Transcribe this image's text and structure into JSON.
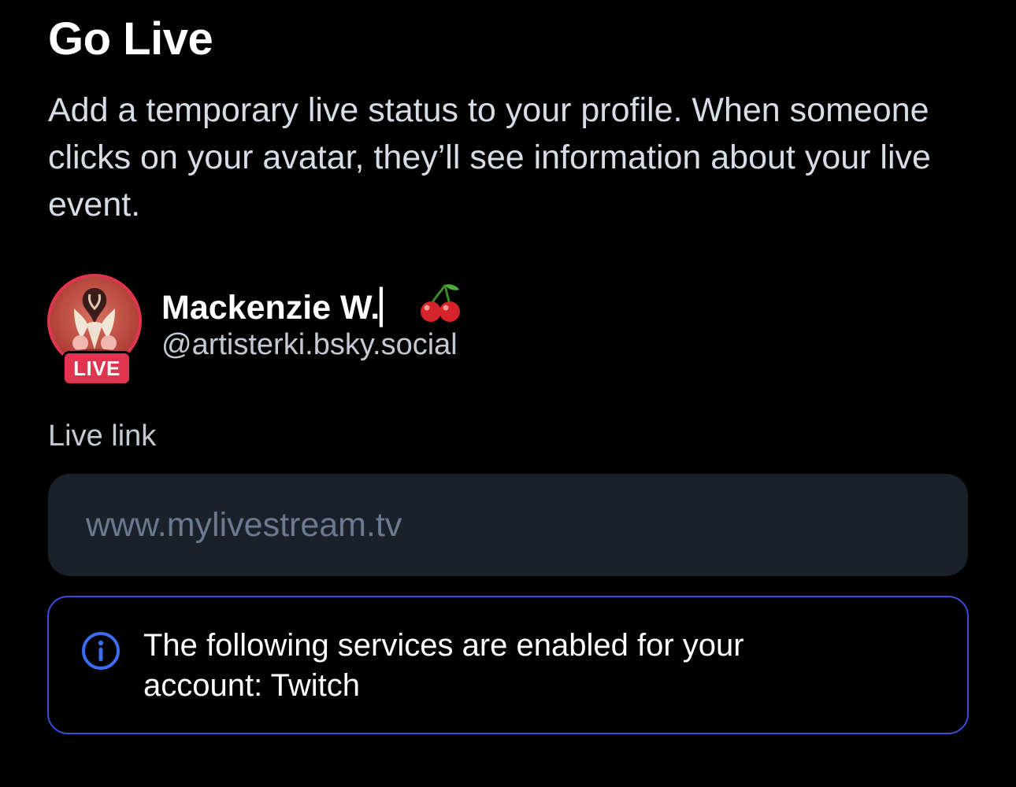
{
  "page": {
    "title": "Go Live",
    "description": "Add a temporary live status to your profile. When someone clicks on your avatar, they’ll see information about your live event."
  },
  "profile": {
    "display_name": "Mackenzie W.▏",
    "display_name_emoji": "🍒",
    "handle": "@artisterki.bsky.social",
    "live_badge": "LIVE",
    "avatar_icon": "avatar-illustration"
  },
  "live_link": {
    "label": "Live link",
    "value": "",
    "placeholder": "www.mylivestream.tv"
  },
  "notice": {
    "icon": "info-icon",
    "text": "The following services are enabled for your account: Twitch"
  },
  "colors": {
    "background": "#000000",
    "live_accent": "#e0344f",
    "info_accent": "#3a4fd8",
    "input_bg": "#1b212b"
  }
}
